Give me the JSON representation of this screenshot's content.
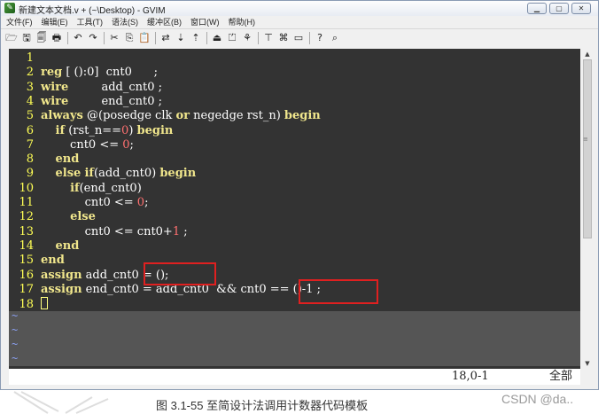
{
  "window": {
    "title": "新建文本文档.v + (~\\Desktop) - GVIM",
    "app_icon_glyph": "✎",
    "controls": [
      "▁",
      "▢",
      "✕"
    ]
  },
  "menu": [
    "文件(F)",
    "编辑(E)",
    "工具(T)",
    "语法(S)",
    "缓冲区(B)",
    "窗口(W)",
    "帮助(H)"
  ],
  "toolbar": {
    "open": "🗁",
    "save": "🖫",
    "save_all": "🗐",
    "print": "🖶",
    "undo": "↶",
    "redo": "↷",
    "cut": "✂",
    "copy": "⎘",
    "paste": "📋",
    "replace": "⇄",
    "find_next": "⇣",
    "find_prev": "⇡",
    "load_session": "⏏",
    "save_session": "⏍",
    "run_script": "⚘",
    "make": "⊤",
    "shell": "⌘",
    "tags": "▭",
    "help": "?",
    "find_help": "⌕"
  },
  "editor": {
    "lines": [
      {
        "n": "1",
        "s": [
          {
            "t": ""
          }
        ]
      },
      {
        "n": "2",
        "s": [
          {
            "t": "reg",
            "c": "kw"
          },
          {
            "t": " [ ():0]  cnt0      ;"
          }
        ]
      },
      {
        "n": "3",
        "s": [
          {
            "t": "wire",
            "c": "kw"
          },
          {
            "t": "         add_cnt0 ;"
          }
        ]
      },
      {
        "n": "4",
        "s": [
          {
            "t": "wire",
            "c": "kw"
          },
          {
            "t": "         end_cnt0 ;"
          }
        ]
      },
      {
        "n": "5",
        "s": [
          {
            "t": "always",
            "c": "kw"
          },
          {
            "t": " @(posedge clk "
          },
          {
            "t": "or",
            "c": "kw"
          },
          {
            "t": " negedge rst_n) "
          },
          {
            "t": "begin",
            "c": "kw"
          }
        ]
      },
      {
        "n": "6",
        "s": [
          {
            "t": "    "
          },
          {
            "t": "if",
            "c": "kw"
          },
          {
            "t": " (rst_n=="
          },
          {
            "t": "0",
            "c": "num"
          },
          {
            "t": ") "
          },
          {
            "t": "begin",
            "c": "kw"
          }
        ]
      },
      {
        "n": "7",
        "s": [
          {
            "t": "        cnt0 <= "
          },
          {
            "t": "0",
            "c": "num"
          },
          {
            "t": ";"
          }
        ]
      },
      {
        "n": "8",
        "s": [
          {
            "t": "    "
          },
          {
            "t": "end",
            "c": "kw"
          }
        ]
      },
      {
        "n": "9",
        "s": [
          {
            "t": "    "
          },
          {
            "t": "else",
            "c": "kw"
          },
          {
            "t": " "
          },
          {
            "t": "if",
            "c": "kw"
          },
          {
            "t": "(add_cnt0) "
          },
          {
            "t": "begin",
            "c": "kw"
          }
        ]
      },
      {
        "n": "10",
        "s": [
          {
            "t": "        "
          },
          {
            "t": "if",
            "c": "kw"
          },
          {
            "t": "(end_cnt0)"
          }
        ]
      },
      {
        "n": "11",
        "s": [
          {
            "t": "            cnt0 <= "
          },
          {
            "t": "0",
            "c": "num"
          },
          {
            "t": ";"
          }
        ]
      },
      {
        "n": "12",
        "s": [
          {
            "t": "        "
          },
          {
            "t": "else",
            "c": "kw"
          }
        ]
      },
      {
        "n": "13",
        "s": [
          {
            "t": "            cnt0 <= cnt0+"
          },
          {
            "t": "1",
            "c": "num"
          },
          {
            "t": " ;"
          }
        ]
      },
      {
        "n": "14",
        "s": [
          {
            "t": "    "
          },
          {
            "t": "end",
            "c": "kw"
          }
        ]
      },
      {
        "n": "15",
        "s": [
          {
            "t": "end",
            "c": "kw"
          }
        ]
      },
      {
        "n": "16",
        "s": [
          {
            "t": "assign",
            "c": "kw"
          },
          {
            "t": " add_cnt0 = ();"
          }
        ]
      },
      {
        "n": "17",
        "s": [
          {
            "t": "assign",
            "c": "kw"
          },
          {
            "t": " end_cnt0 = add_cnt0  && cnt0 == ()-1 ;"
          }
        ]
      },
      {
        "n": "18",
        "s": [],
        "cursor": true
      }
    ],
    "filler": [
      "~",
      "~",
      "~",
      "~"
    ]
  },
  "status": {
    "position": "18,0-1",
    "percent": "全部"
  },
  "caption": "图 3.1-55 至简设计法调用计数器代码模板",
  "watermark": "CSDN @da.."
}
